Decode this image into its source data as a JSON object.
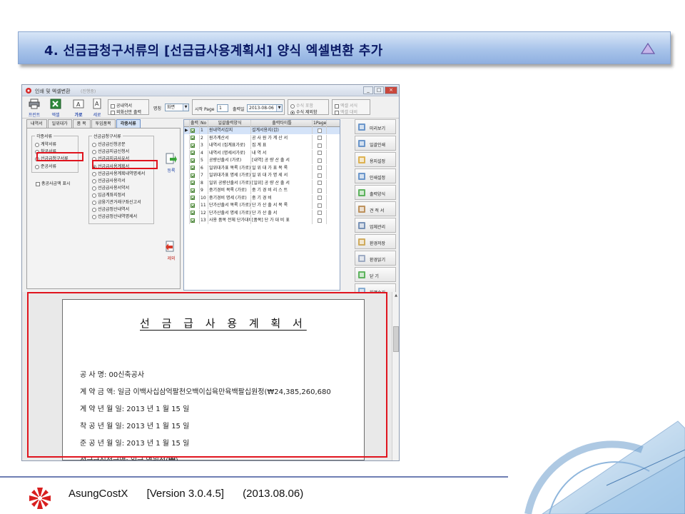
{
  "slide": {
    "title": "4. 선금급청구서류의  [선금급사용계획서]  양식  엑셀변환  추가",
    "footer": {
      "product": "AsungCostX",
      "version": "[Version 3.0.4.5]",
      "date": "(2013.08.06)"
    }
  },
  "window": {
    "title": "인쇄 및 엑셀변환",
    "subtitle": "(진행중)",
    "controls": {
      "minimize": "_",
      "maximize": "□",
      "close": "×"
    }
  },
  "toolbar": {
    "print_label": "프린트",
    "excel_label": "엑셀",
    "landscape_label": "가로",
    "portrait_label": "세로",
    "opt_external": "공내역서",
    "opt_foreign": "외화산만 출력",
    "pattern_label": "명칭",
    "pattern_value": "화면",
    "start_page_label": "시작 Page",
    "start_page_value": "1",
    "output_date_label": "출력일",
    "output_date_value": "2013-08-06",
    "opt_amount_include": "수식 포함",
    "opt_amount_exclude": "수식 제외함",
    "opt_excel_format": "엑셀 서식",
    "opt_excel_contrast": "엑셀 대비"
  },
  "tabs": [
    "내역서",
    "일위대가",
    "품 목",
    "투입품목",
    "각종서류"
  ],
  "active_tab": "각종서류",
  "left_panel": {
    "group1_caption": "각종서류",
    "group1_items": [
      "계약서류",
      "착공서류",
      "선금급청구서류",
      "준공서류"
    ],
    "group1_selected": "선금급청구서류",
    "total_amount_option": "총공사금액 표시",
    "group2_caption": "선금급청구서류",
    "group2_items": [
      "선금급신청공문",
      "선금급지급신청서",
      "선금급지급사유서",
      "선금급사용계획서",
      "선금급사용계획내역명세서",
      "선금급사용각서",
      "선금급사용서약서",
      "입금계좌지정서",
      "금융기관거래구좌신고서",
      "선금급정산내역서",
      "선금급정산내역명세서"
    ],
    "group2_selected": "선금급사용계획서"
  },
  "middle_buttons": {
    "register": "등록",
    "remove": "제외"
  },
  "grid": {
    "headers": [
      "출력",
      "No",
      "일괄출력양식",
      "출력타이틀",
      "1Page"
    ],
    "rows": [
      {
        "no": "1",
        "form": "원내역서갑지",
        "title": "설계서용지(갑)"
      },
      {
        "no": "2",
        "form": "원가계산서",
        "title": "공 사 원 가 계 산 서"
      },
      {
        "no": "3",
        "form": "내역서 (집계표가로)",
        "title": "집          계          표"
      },
      {
        "no": "4",
        "form": "내역서 (명세서가로)",
        "title": "내          역          서"
      },
      {
        "no": "5",
        "form": "공량산출서 (가로)",
        "title": "[내역] 공 량 산 출 서"
      },
      {
        "no": "6",
        "form": "일위대가표 목록 (가로)",
        "title": "일 위 대 가 표 목 록"
      },
      {
        "no": "7",
        "form": "일위대가표 명세 (가로)",
        "title": "일 위 대 가 명 세 서"
      },
      {
        "no": "8",
        "form": "일위 공량산출서 (가로)",
        "title": "[일위] 공 량 산 출 서"
      },
      {
        "no": "9",
        "form": "중기경비 목록 (가로)",
        "title": "중 기 경 비 리 스 트"
      },
      {
        "no": "10",
        "form": "중기경비 명세 (가로)",
        "title": "중     기     경     비"
      },
      {
        "no": "11",
        "form": "단가산출서 목록 (가로)",
        "title": "단 가 산 출 서 목 록"
      },
      {
        "no": "12",
        "form": "단가산출서 명세 (가로)",
        "title": "단     가     산     출     서"
      },
      {
        "no": "13",
        "form": "사용 품목 전체 단가대비표",
        "title": "[품목] 단 가 대 비 표"
      }
    ]
  },
  "right_buttons": [
    "미리보기",
    "일괄인쇄",
    "용지설정",
    "인쇄설정",
    "출력양식",
    "견 적 서",
    "업체관리",
    "환경저장",
    "환경읽기",
    "닫    기",
    "화면숨김"
  ],
  "preview": {
    "title": "선 금 급 사 용 계 획 서",
    "lines": [
      "공      사      명: 00신축공사",
      "계    약    금    액: 일금 이백사십삼억팔천오백이십육만육백팔십원정(₩24,385,260,680",
      "계  약  년  월  일: 2013 년  1 월  15 일",
      "착  공  년  월  일: 2013 년  1 월  15 일",
      "준  공  년  월  일: 2013 년  1 월  15 일",
      "선금급신청금액: 일금 영원정(₩)"
    ]
  },
  "colors": {
    "highlight": "#e0141e",
    "title_text": "#0b1a66",
    "link_blue": "#1a3ea8"
  }
}
